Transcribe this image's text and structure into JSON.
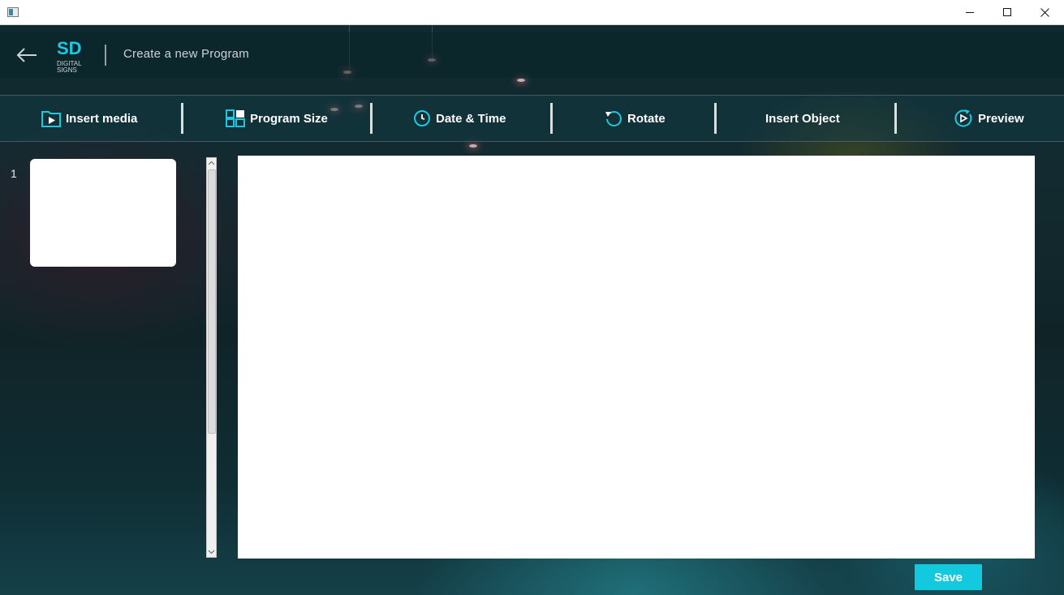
{
  "window": {
    "controls": {
      "minimize_icon": "minimize-icon",
      "maximize_icon": "maximize-icon",
      "close_icon": "close-icon"
    }
  },
  "header": {
    "back_icon": "arrow-left-icon",
    "logo": {
      "mark": "SD",
      "line1": "DIGITAL",
      "line2": "SIGNS"
    },
    "title": "Create a new Program"
  },
  "toolbar": {
    "items": [
      {
        "label": "Insert media",
        "icon": "play-folder-icon"
      },
      {
        "label": "Program Size",
        "icon": "grid-layout-icon"
      },
      {
        "label": "Date & Time",
        "icon": "clock-icon"
      },
      {
        "label": "Rotate",
        "icon": "rotate-icon"
      },
      {
        "label": "Insert Object",
        "icon": ""
      },
      {
        "label": "Preview",
        "icon": "preview-play-icon"
      }
    ]
  },
  "slides": {
    "items": [
      {
        "number": "1"
      }
    ]
  },
  "actions": {
    "save_label": "Save"
  },
  "colors": {
    "accent": "#12c9dd",
    "icon_accent": "#1ec8e0",
    "toolbar_text": "#ffffff",
    "header_text": "#c9d3d6"
  }
}
